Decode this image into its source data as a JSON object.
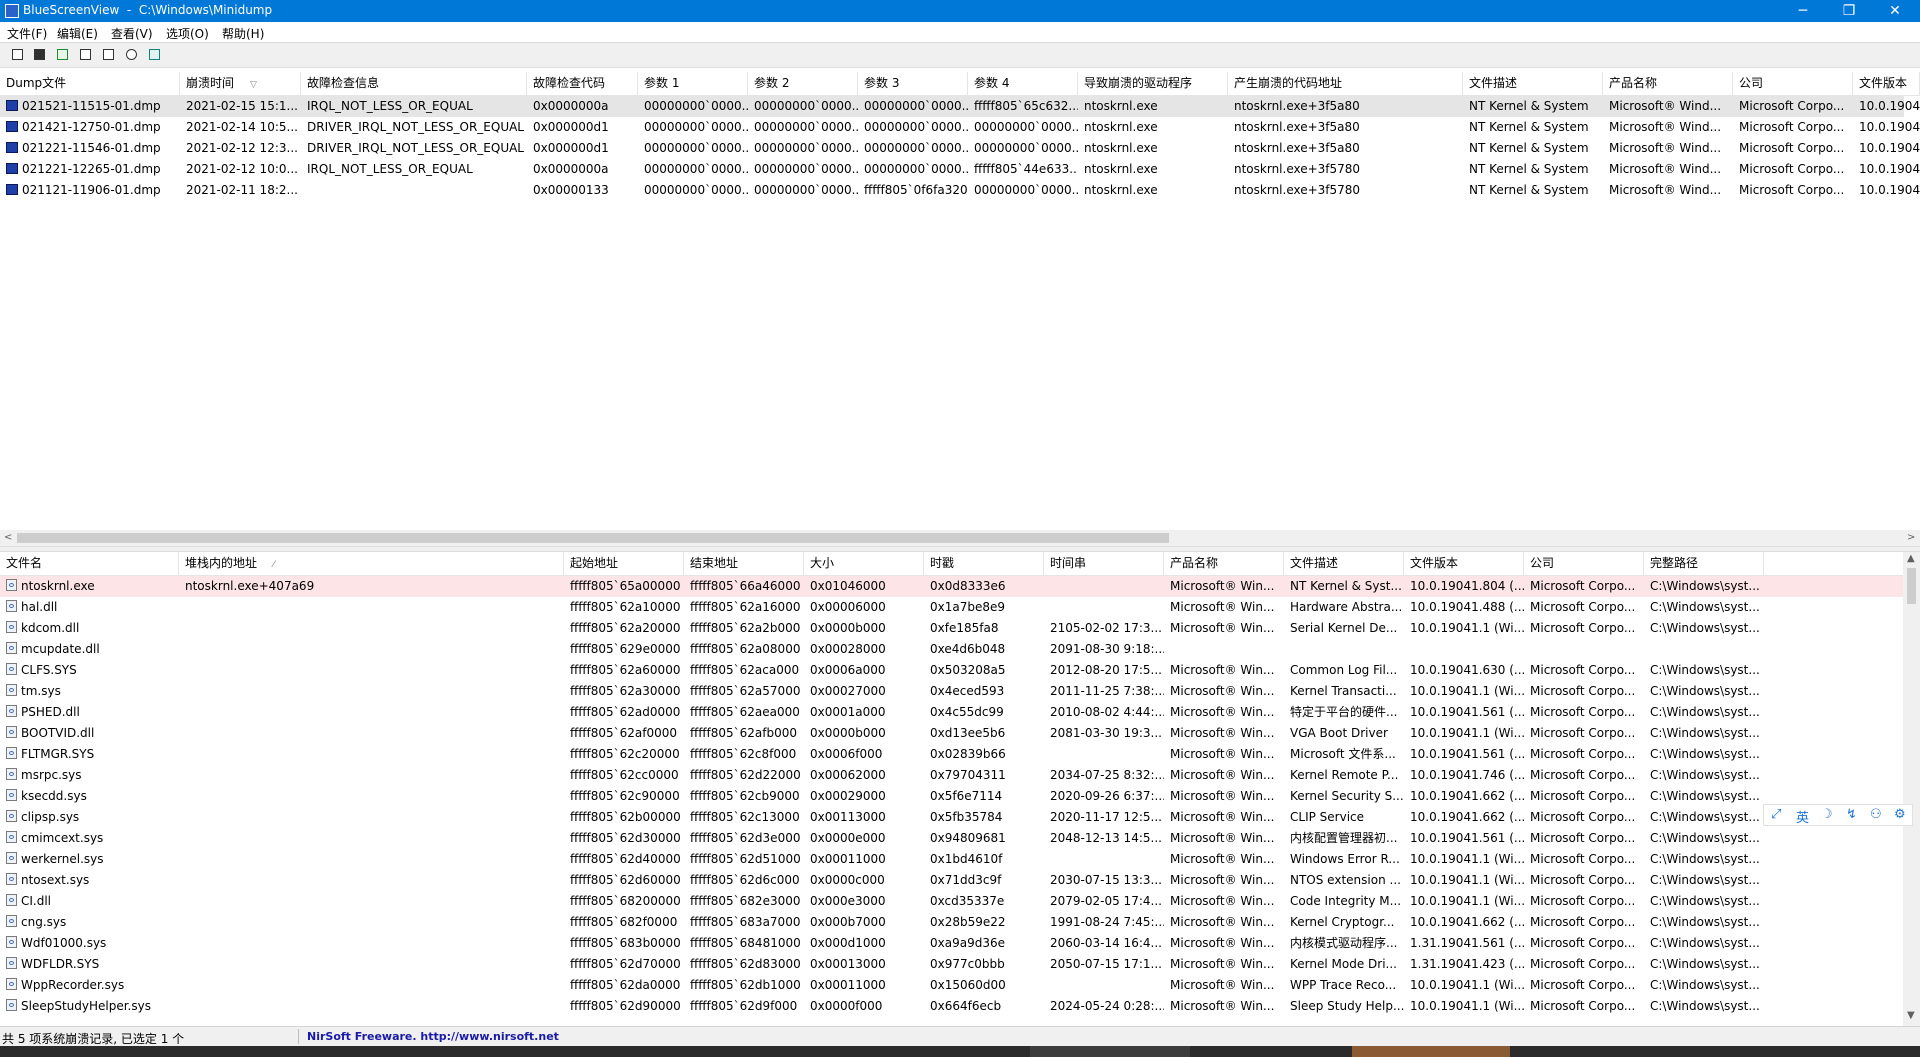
{
  "window": {
    "title": "BlueScreenView  -  C:\\Windows\\Minidump",
    "controls": {
      "minimize": "─",
      "restore": "❐",
      "close": "✕"
    }
  },
  "menu": [
    "文件(F)",
    "编辑(E)",
    "查看(V)",
    "选项(O)",
    "帮助(H)"
  ],
  "toolbar_icons": [
    "properties-icon",
    "save-icon",
    "refresh-icon",
    "copy-icon",
    "options-icon",
    "find-icon",
    "exit-icon"
  ],
  "upper_table": {
    "columns": [
      "Dump文件",
      "崩溃时间",
      "故障检查信息",
      "故障检查代码",
      "参数 1",
      "参数 2",
      "参数 3",
      "参数 4",
      "导致崩溃的驱动程序",
      "产生崩溃的代码地址",
      "文件描述",
      "产品名称",
      "公司",
      "文件版本"
    ],
    "sort_indicator": "▽",
    "rows": [
      [
        "021521-11515-01.dmp",
        "2021-02-15 15:1...",
        "IRQL_NOT_LESS_OR_EQUAL",
        "0x0000000a",
        "00000000`0000...",
        "00000000`0000...",
        "00000000`0000...",
        "fffff805`65c632...",
        "ntoskrnl.exe",
        "ntoskrnl.exe+3f5a80",
        "NT Kernel & System",
        "Microsoft® Wind...",
        "Microsoft Corpo...",
        "10.0.19041"
      ],
      [
        "021421-12750-01.dmp",
        "2021-02-14 10:5...",
        "DRIVER_IRQL_NOT_LESS_OR_EQUAL",
        "0x000000d1",
        "00000000`0000...",
        "00000000`0000...",
        "00000000`0000...",
        "00000000`0000...",
        "ntoskrnl.exe",
        "ntoskrnl.exe+3f5a80",
        "NT Kernel & System",
        "Microsoft® Wind...",
        "Microsoft Corpo...",
        "10.0.19041"
      ],
      [
        "021221-11546-01.dmp",
        "2021-02-12 12:3...",
        "DRIVER_IRQL_NOT_LESS_OR_EQUAL",
        "0x000000d1",
        "00000000`0000...",
        "00000000`0000...",
        "00000000`0000...",
        "00000000`0000...",
        "ntoskrnl.exe",
        "ntoskrnl.exe+3f5a80",
        "NT Kernel & System",
        "Microsoft® Wind...",
        "Microsoft Corpo...",
        "10.0.19041"
      ],
      [
        "021221-12265-01.dmp",
        "2021-02-12 10:0...",
        "IRQL_NOT_LESS_OR_EQUAL",
        "0x0000000a",
        "00000000`0000...",
        "00000000`0000...",
        "00000000`0000...",
        "fffff805`44e633...",
        "ntoskrnl.exe",
        "ntoskrnl.exe+3f5780",
        "NT Kernel & System",
        "Microsoft® Wind...",
        "Microsoft Corpo...",
        "10.0.19041"
      ],
      [
        "021121-11906-01.dmp",
        "2021-02-11 18:2...",
        "",
        "0x00000133",
        "00000000`0000...",
        "00000000`0000...",
        "fffff805`0f6fa320",
        "00000000`0000...",
        "ntoskrnl.exe",
        "ntoskrnl.exe+3f5780",
        "NT Kernel & System",
        "Microsoft® Wind...",
        "Microsoft Corpo...",
        "10.0.19041"
      ]
    ]
  },
  "lower_table": {
    "columns": [
      "文件名",
      "堆栈内的地址",
      "起始地址",
      "结束地址",
      "大小",
      "时戳",
      "时间串",
      "产品名称",
      "文件描述",
      "文件版本",
      "公司",
      "完整路径"
    ],
    "sort_indicator": "⁄",
    "rows": [
      [
        "ntoskrnl.exe",
        "ntoskrnl.exe+407a69",
        "fffff805`65a00000",
        "fffff805`66a46000",
        "0x01046000",
        "0x0d8333e6",
        "",
        "Microsoft® Win...",
        "NT Kernel & Syst...",
        "10.0.19041.804 (...",
        "Microsoft Corpo...",
        "C:\\Windows\\syst..."
      ],
      [
        "hal.dll",
        "",
        "fffff805`62a10000",
        "fffff805`62a16000",
        "0x00006000",
        "0x1a7be8e9",
        "",
        "Microsoft® Win...",
        "Hardware Abstra...",
        "10.0.19041.488 (...",
        "Microsoft Corpo...",
        "C:\\Windows\\syst..."
      ],
      [
        "kdcom.dll",
        "",
        "fffff805`62a20000",
        "fffff805`62a2b000",
        "0x0000b000",
        "0xfe185fa8",
        "2105-02-02 17:3...",
        "Microsoft® Win...",
        "Serial Kernel De...",
        "10.0.19041.1 (Wi...",
        "Microsoft Corpo...",
        "C:\\Windows\\syst..."
      ],
      [
        "mcupdate.dll",
        "",
        "fffff805`629e0000",
        "fffff805`62a08000",
        "0x00028000",
        "0xe4d6b048",
        "2091-08-30 9:18:...",
        "",
        "",
        "",
        "",
        ""
      ],
      [
        "CLFS.SYS",
        "",
        "fffff805`62a60000",
        "fffff805`62aca000",
        "0x0006a000",
        "0x503208a5",
        "2012-08-20 17:5...",
        "Microsoft® Win...",
        "Common Log Fil...",
        "10.0.19041.630 (...",
        "Microsoft Corpo...",
        "C:\\Windows\\syst..."
      ],
      [
        "tm.sys",
        "",
        "fffff805`62a30000",
        "fffff805`62a57000",
        "0x00027000",
        "0x4eced593",
        "2011-11-25 7:38:...",
        "Microsoft® Win...",
        "Kernel Transacti...",
        "10.0.19041.1 (Wi...",
        "Microsoft Corpo...",
        "C:\\Windows\\syst..."
      ],
      [
        "PSHED.dll",
        "",
        "fffff805`62ad0000",
        "fffff805`62aea000",
        "0x0001a000",
        "0x4c55dc99",
        "2010-08-02 4:44:...",
        "Microsoft® Win...",
        "特定于平台的硬件...",
        "10.0.19041.561 (...",
        "Microsoft Corpo...",
        "C:\\Windows\\syst..."
      ],
      [
        "BOOTVID.dll",
        "",
        "fffff805`62af0000",
        "fffff805`62afb000",
        "0x0000b000",
        "0xd13ee5b6",
        "2081-03-30 19:3...",
        "Microsoft® Win...",
        "VGA Boot Driver",
        "10.0.19041.1 (Wi...",
        "Microsoft Corpo...",
        "C:\\Windows\\syst..."
      ],
      [
        "FLTMGR.SYS",
        "",
        "fffff805`62c20000",
        "fffff805`62c8f000",
        "0x0006f000",
        "0x02839b66",
        "",
        "Microsoft® Win...",
        "Microsoft 文件系...",
        "10.0.19041.561 (...",
        "Microsoft Corpo...",
        "C:\\Windows\\syst..."
      ],
      [
        "msrpc.sys",
        "",
        "fffff805`62cc0000",
        "fffff805`62d22000",
        "0x00062000",
        "0x79704311",
        "2034-07-25 8:32:...",
        "Microsoft® Win...",
        "Kernel Remote P...",
        "10.0.19041.746 (...",
        "Microsoft Corpo...",
        "C:\\Windows\\syst..."
      ],
      [
        "ksecdd.sys",
        "",
        "fffff805`62c90000",
        "fffff805`62cb9000",
        "0x00029000",
        "0x5f6e7114",
        "2020-09-26 6:37:...",
        "Microsoft® Win...",
        "Kernel Security S...",
        "10.0.19041.662 (...",
        "Microsoft Corpo...",
        "C:\\Windows\\syst..."
      ],
      [
        "clipsp.sys",
        "",
        "fffff805`62b00000",
        "fffff805`62c13000",
        "0x00113000",
        "0x5fb35784",
        "2020-11-17 12:5...",
        "Microsoft® Win...",
        "CLIP Service",
        "10.0.19041.662 (...",
        "Microsoft Corpo...",
        "C:\\Windows\\syst..."
      ],
      [
        "cmimcext.sys",
        "",
        "fffff805`62d30000",
        "fffff805`62d3e000",
        "0x0000e000",
        "0x94809681",
        "2048-12-13 14:5...",
        "Microsoft® Win...",
        "内核配置管理器初...",
        "10.0.19041.561 (...",
        "Microsoft Corpo...",
        "C:\\Windows\\syst..."
      ],
      [
        "werkernel.sys",
        "",
        "fffff805`62d40000",
        "fffff805`62d51000",
        "0x00011000",
        "0x1bd4610f",
        "",
        "Microsoft® Win...",
        "Windows Error R...",
        "10.0.19041.1 (Wi...",
        "Microsoft Corpo...",
        "C:\\Windows\\syst..."
      ],
      [
        "ntosext.sys",
        "",
        "fffff805`62d60000",
        "fffff805`62d6c000",
        "0x0000c000",
        "0x71dd3c9f",
        "2030-07-15 13:3...",
        "Microsoft® Win...",
        "NTOS extension ...",
        "10.0.19041.1 (Wi...",
        "Microsoft Corpo...",
        "C:\\Windows\\syst..."
      ],
      [
        "CI.dll",
        "",
        "fffff805`68200000",
        "fffff805`682e3000",
        "0x000e3000",
        "0xcd35337e",
        "2079-02-05 17:4...",
        "Microsoft® Win...",
        "Code Integrity M...",
        "10.0.19041.1 (Wi...",
        "Microsoft Corpo...",
        "C:\\Windows\\syst..."
      ],
      [
        "cng.sys",
        "",
        "fffff805`682f0000",
        "fffff805`683a7000",
        "0x000b7000",
        "0x28b59e22",
        "1991-08-24 7:45:...",
        "Microsoft® Win...",
        "Kernel Cryptogr...",
        "10.0.19041.662 (...",
        "Microsoft Corpo...",
        "C:\\Windows\\syst..."
      ],
      [
        "Wdf01000.sys",
        "",
        "fffff805`683b0000",
        "fffff805`68481000",
        "0x000d1000",
        "0xa9a9d36e",
        "2060-03-14 16:4...",
        "Microsoft® Win...",
        "内核模式驱动程序...",
        "1.31.19041.561 (...",
        "Microsoft Corpo...",
        "C:\\Windows\\syst..."
      ],
      [
        "WDFLDR.SYS",
        "",
        "fffff805`62d70000",
        "fffff805`62d83000",
        "0x00013000",
        "0x977c0bbb",
        "2050-07-15 17:1...",
        "Microsoft® Win...",
        "Kernel Mode Dri...",
        "1.31.19041.423 (...",
        "Microsoft Corpo...",
        "C:\\Windows\\syst..."
      ],
      [
        "WppRecorder.sys",
        "",
        "fffff805`62da0000",
        "fffff805`62db1000",
        "0x00011000",
        "0x15060d00",
        "",
        "Microsoft® Win...",
        "WPP Trace Reco...",
        "10.0.19041.1 (Wi...",
        "Microsoft Corpo...",
        "C:\\Windows\\syst..."
      ],
      [
        "SleepStudyHelper.sys",
        "",
        "fffff805`62d90000",
        "fffff805`62d9f000",
        "0x0000f000",
        "0x664f6ecb",
        "2024-05-24 0:28:...",
        "Microsoft® Win...",
        "Sleep Study Help...",
        "10.0.19041.1 (Wi...",
        "Microsoft Corpo...",
        "C:\\Windows\\syst..."
      ]
    ]
  },
  "ime": [
    "英",
    "☽",
    "↯",
    "⚇",
    "⚙"
  ],
  "status": {
    "summary": "共 5 项系统崩溃记录, 已选定 1 个",
    "credit": "NirSoft Freeware.  http://www.nirsoft.net"
  }
}
